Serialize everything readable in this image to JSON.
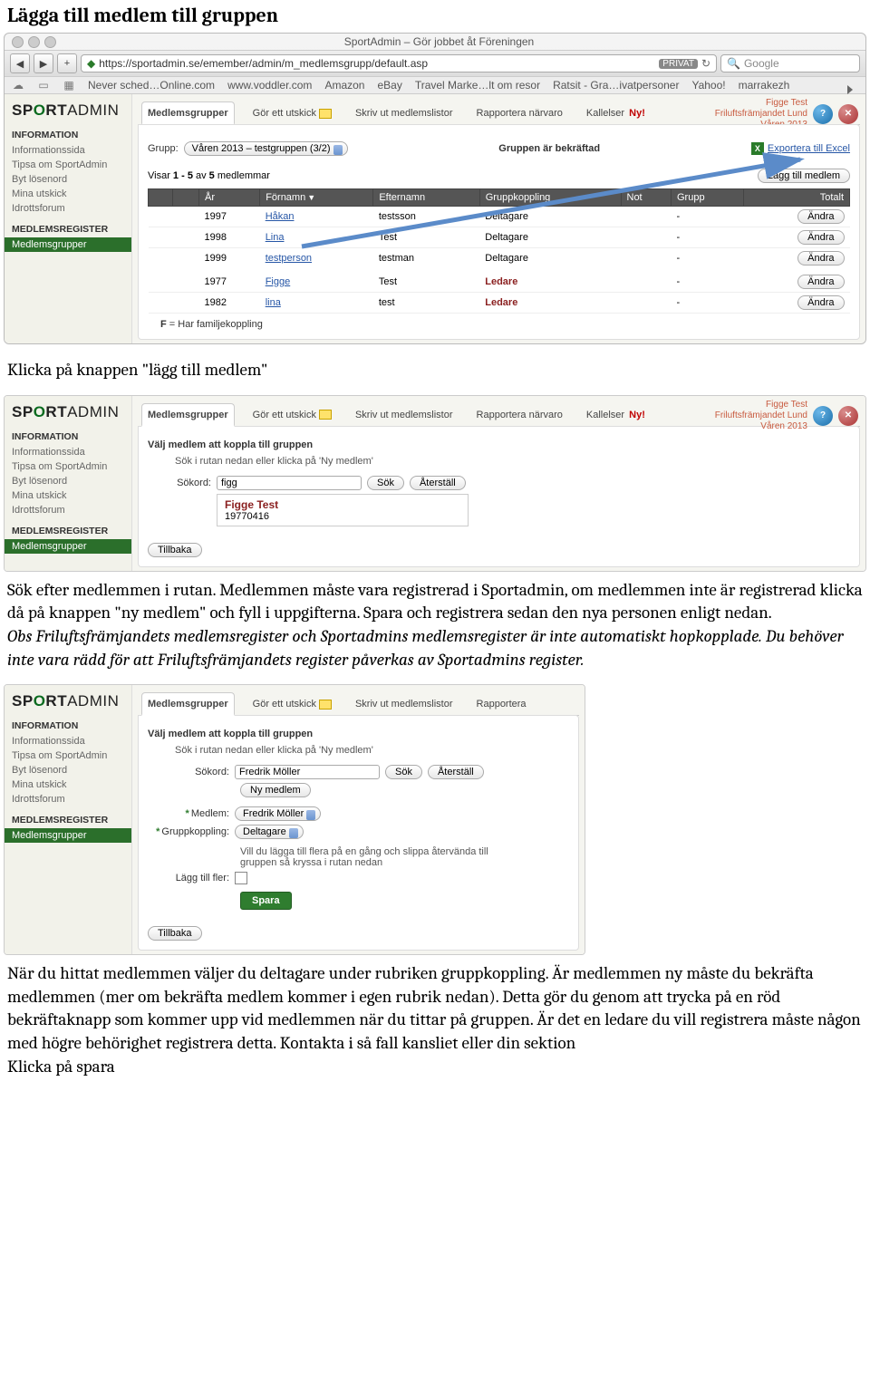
{
  "doc": {
    "title": "Lägga till medlem till gruppen",
    "p1": "Klicka på knappen \"lägg till medlem\"",
    "p2": "Sök efter medlemmen i rutan. Medlemmen måste vara registrerad i Sportadmin, om medlemmen inte är registrerad klicka då på knappen \"ny medlem\" och fyll i uppgifterna. Spara och registrera sedan den nya personen enligt nedan.",
    "p2_italic": "Obs Friluftsfrämjandets medlemsregister och Sportadmins medlemsregister är inte automatiskt hopkopplade. Du behöver inte vara rädd för att Friluftsfrämjandets register påverkas av Sportadmins register.",
    "p3": "När du hittat medlemmen väljer du deltagare under rubriken gruppkoppling. Är medlemmen ny måste du bekräfta medlemmen (mer om bekräfta medlem kommer i egen rubrik nedan). Detta gör du genom att trycka på en röd bekräftaknapp som kommer upp vid medlemmen när du tittar på gruppen. Är det en ledare du vill registrera måste någon med högre behörighet registrera detta. Kontakta i så fall kansliet eller din sektion",
    "p4": "Klicka på spara"
  },
  "browser": {
    "title": "SportAdmin – Gör jobbet åt Föreningen",
    "url": "https://sportadmin.se/emember/admin/m_medlemsgrupp/default.asp",
    "privat": "PRIVAT",
    "search_placeholder": "Google",
    "bookmarks": [
      "Never sched…Online.com",
      "www.voddler.com",
      "Amazon",
      "eBay",
      "Travel Marke…lt om resor",
      "Ratsit - Gra…ivatpersoner",
      "Yahoo!",
      "marrakezh"
    ]
  },
  "app": {
    "logo_a": "SP",
    "logo_b": "O",
    "logo_c": "RT",
    "logo_d": "ADMIN",
    "sidebar": {
      "info_head": "INFORMATION",
      "info_items": [
        "Informationssida",
        "Tipsa om SportAdmin",
        "Byt lösenord",
        "Mina utskick",
        "Idrottsforum"
      ],
      "reg_head": "MEDLEMSREGISTER",
      "reg_active": "Medlemsgrupper"
    },
    "tabs": {
      "t1": "Medlemsgrupper",
      "t2": "Gör ett utskick",
      "t3": "Skriv ut medlemslistor",
      "t4": "Rapportera närvaro",
      "t5": "Kallelser",
      "ny": "Ny!"
    },
    "header_user": {
      "l1": "Figge Test",
      "l2": "Friluftsfrämjandet Lund",
      "l3": "Våren 2013"
    }
  },
  "shot1": {
    "group_label": "Grupp:",
    "group_value": "Våren 2013 – testgruppen (3/2)",
    "confirmed": "Gruppen är bekräftad",
    "export": "Exportera till Excel",
    "count_a": "Visar ",
    "count_b": "1 - 5",
    "count_c": " av ",
    "count_d": "5",
    "count_e": " medlemmar",
    "add_btn": "Lägg till medlem",
    "cols": {
      "ar": "År",
      "fornamn": "Förnamn",
      "efternamn": "Efternamn",
      "grupp": "Gruppkoppling",
      "not": "Not",
      "gr": "Grupp",
      "totalt": "Totalt"
    },
    "rows": [
      {
        "ar": "1997",
        "fn": "Håkan",
        "en": "testsson",
        "gk": "Deltagare",
        "not": "-",
        "btn": "Ändra"
      },
      {
        "ar": "1998",
        "fn": "Lina",
        "en": "Test",
        "gk": "Deltagare",
        "not": "-",
        "btn": "Ändra"
      },
      {
        "ar": "1999",
        "fn": "testperson",
        "en": "testman",
        "gk": "Deltagare",
        "not": "-",
        "btn": "Ändra"
      },
      {
        "ar": "1977",
        "fn": "Figge",
        "en": "Test",
        "gk": "Ledare",
        "not": "-",
        "btn": "Ändra"
      },
      {
        "ar": "1982",
        "fn": "lina",
        "en": "test",
        "gk": "Ledare",
        "not": "-",
        "btn": "Ändra"
      }
    ],
    "footer": "F = Har familjekoppling"
  },
  "shot2": {
    "heading": "Välj medlem att koppla till gruppen",
    "hint": "Sök i rutan nedan eller klicka på 'Ny medlem'",
    "sokord_label": "Sökord:",
    "sokord_value": "figg",
    "sok": "Sök",
    "aterstall": "Återställ",
    "res_name": "Figge Test",
    "res_dob": "19770416",
    "tillbaka": "Tillbaka"
  },
  "shot3": {
    "heading": "Välj medlem att koppla till gruppen",
    "hint": "Sök i rutan nedan eller klicka på 'Ny medlem'",
    "sokord_label": "Sökord:",
    "sokord_value": "Fredrik Möller",
    "sok": "Sök",
    "aterstall": "Återställ",
    "nymedlem": "Ny medlem",
    "medlem_label": "Medlem:",
    "medlem_value": "Fredrik Möller",
    "gk_label": "Gruppkoppling:",
    "gk_value": "Deltagare",
    "multi_text": "Vill du lägga till flera på en gång och slippa återvända till gruppen så kryssa i rutan nedan",
    "multi_label": "Lägg till fler:",
    "spara": "Spara",
    "tillbaka": "Tillbaka",
    "tabs_short": {
      "t4": "Rapportera"
    }
  }
}
